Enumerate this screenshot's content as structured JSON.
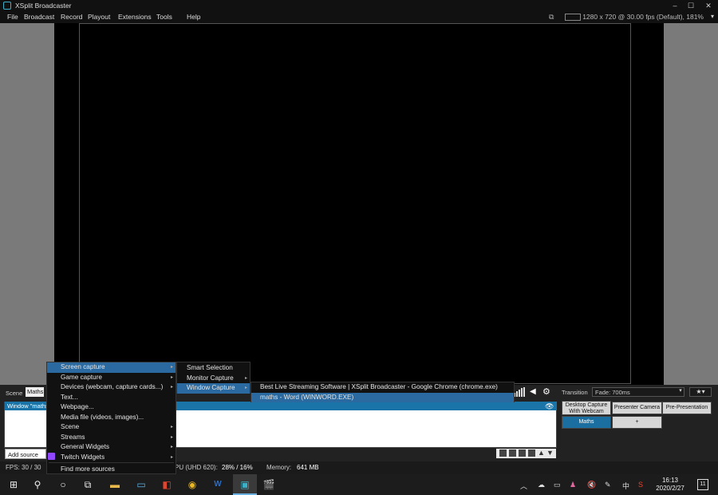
{
  "app": {
    "title": "XSplit Broadcaster",
    "resolution_info": "1280 x 720 @ 30.00 fps (Default), 181%"
  },
  "menubar": {
    "items": [
      "File",
      "Broadcast",
      "Record",
      "Playout",
      "Extensions",
      "Tools",
      "Help"
    ]
  },
  "scene_panel": {
    "label": "Scene",
    "current_scene": "Maths",
    "source_row": "Window \"maths",
    "add_source_label": "Add source"
  },
  "transition": {
    "label": "Transition",
    "value": "Fade: 700ms"
  },
  "scenes": {
    "buttons": [
      "Desktop Capture With Webcam",
      "Presenter Camera",
      "Pre-Presentation",
      "Maths",
      "+"
    ],
    "active": "Maths"
  },
  "statusbar": {
    "fps": "FPS:  30 / 30",
    "gpu": "PU (UHD 620):",
    "gpu_value": "28% / 16%",
    "memory_label": "Memory:",
    "memory_value": "641 MB"
  },
  "add_source_menu": {
    "items": [
      {
        "label": "Screen capture",
        "submenu": true,
        "highlight": true
      },
      {
        "label": "Game capture",
        "submenu": true
      },
      {
        "label": "Devices (webcam, capture cards...)",
        "submenu": true
      },
      {
        "label": "Text...",
        "submenu": false
      },
      {
        "label": "Webpage...",
        "submenu": false
      },
      {
        "label": "Media file (videos, images)...",
        "submenu": false
      },
      {
        "label": "Scene",
        "submenu": true
      },
      {
        "label": "Streams",
        "submenu": true
      },
      {
        "label": "General Widgets",
        "submenu": true
      },
      {
        "label": "Twitch Widgets",
        "submenu": true
      },
      {
        "label": "Find more sources",
        "submenu": false
      }
    ]
  },
  "screen_capture_menu": {
    "items": [
      {
        "label": "Smart Selection",
        "submenu": false
      },
      {
        "label": "Monitor Capture",
        "submenu": true
      },
      {
        "label": "Window Capture",
        "submenu": true,
        "highlight": true
      }
    ]
  },
  "window_capture_menu": {
    "items": [
      {
        "label": "Best Live Streaming Software | XSplit Broadcaster - Google Chrome (chrome.exe)"
      },
      {
        "label": "maths - Word (WINWORD.EXE)",
        "highlight": true
      }
    ]
  },
  "taskbar": {
    "time": "16:13",
    "date": "2020/2/27",
    "ime": "中",
    "notifications": "11"
  },
  "colors": {
    "accent": "#2a6aa0",
    "selected_row": "#1a74a8",
    "titlebar_icon": "#3bb1c9"
  }
}
